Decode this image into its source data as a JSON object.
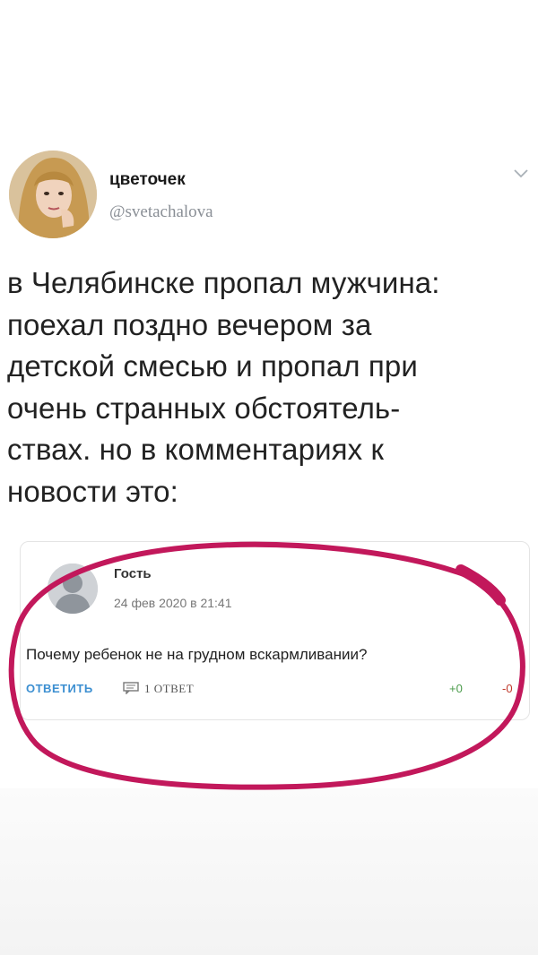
{
  "tweet": {
    "display_name": "цветочек",
    "handle": "@svetachalova",
    "text_lines": [
      "в Челябинске пропал мужчина:",
      "поехал поздно вечером за",
      "детской смесью и пропал при",
      "очень странных обстоятель-",
      "ствах. но в комментариях к",
      "новости это:"
    ]
  },
  "comment": {
    "author": "Гость",
    "date": "24 фев 2020 в 21:41",
    "text": "Почему ребенок не на грудном вскармливании?",
    "reply_label": "ОТВЕТИТЬ",
    "replies_count": "1 ОТВЕТ",
    "upvotes": "+0",
    "downvotes": "-0"
  },
  "icons": {
    "menu": "chevron-down-icon",
    "replies": "comment-icon"
  },
  "colors": {
    "highlight": "#c2185b",
    "reply_link": "#3c8fd1",
    "handle": "#8a8f96"
  }
}
